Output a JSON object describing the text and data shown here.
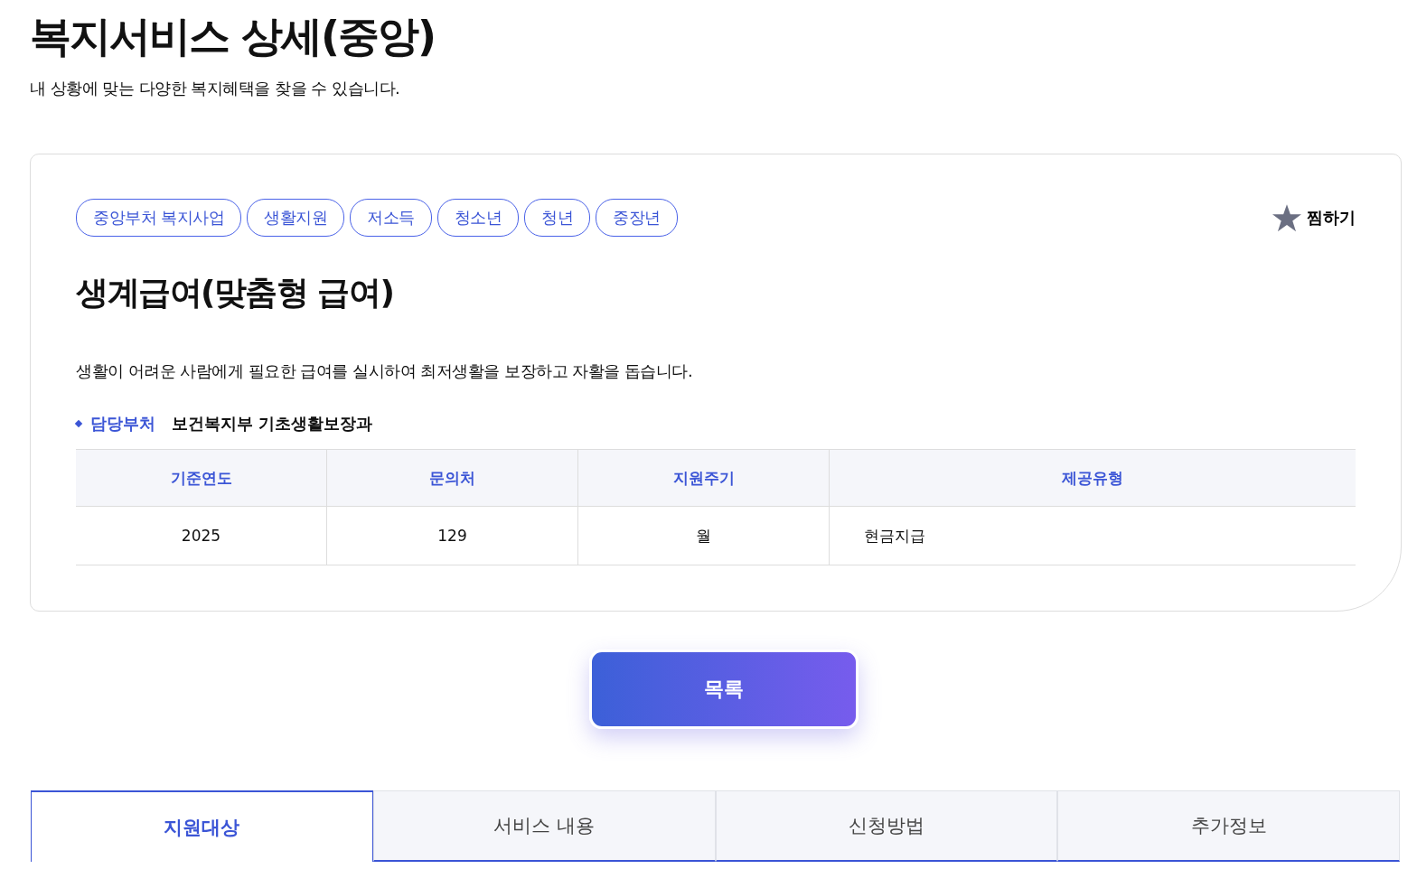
{
  "page": {
    "title": "복지서비스 상세(중앙)",
    "subtitle": "내 상황에 맞는 다양한 복지혜택을 찾을 수 있습니다."
  },
  "service": {
    "tags": [
      "중앙부처 복지사업",
      "생활지원",
      "저소득",
      "청소년",
      "청년",
      "중장년"
    ],
    "favorite": {
      "label": "찜하기",
      "on": false
    },
    "name": "생계급여(맞춤형 급여)",
    "description": "생활이 어려운 사람에게 필요한 급여를 실시하여 최저생활을 보장하고 자활을 돕습니다.",
    "department": {
      "label": "담당부처",
      "value": "보건복지부 기초생활보장과"
    },
    "table": {
      "columns": [
        "기준연도",
        "문의처",
        "지원주기",
        "제공유형"
      ],
      "rows": [
        [
          "2025",
          "129",
          "월",
          "현금지급"
        ]
      ]
    }
  },
  "list_button": "목록",
  "tabs": [
    {
      "label": "지원대상",
      "selected": true
    },
    {
      "label": "서비스 내용",
      "selected": false
    },
    {
      "label": "신청방법",
      "selected": false
    },
    {
      "label": "추가정보",
      "selected": false
    }
  ]
}
